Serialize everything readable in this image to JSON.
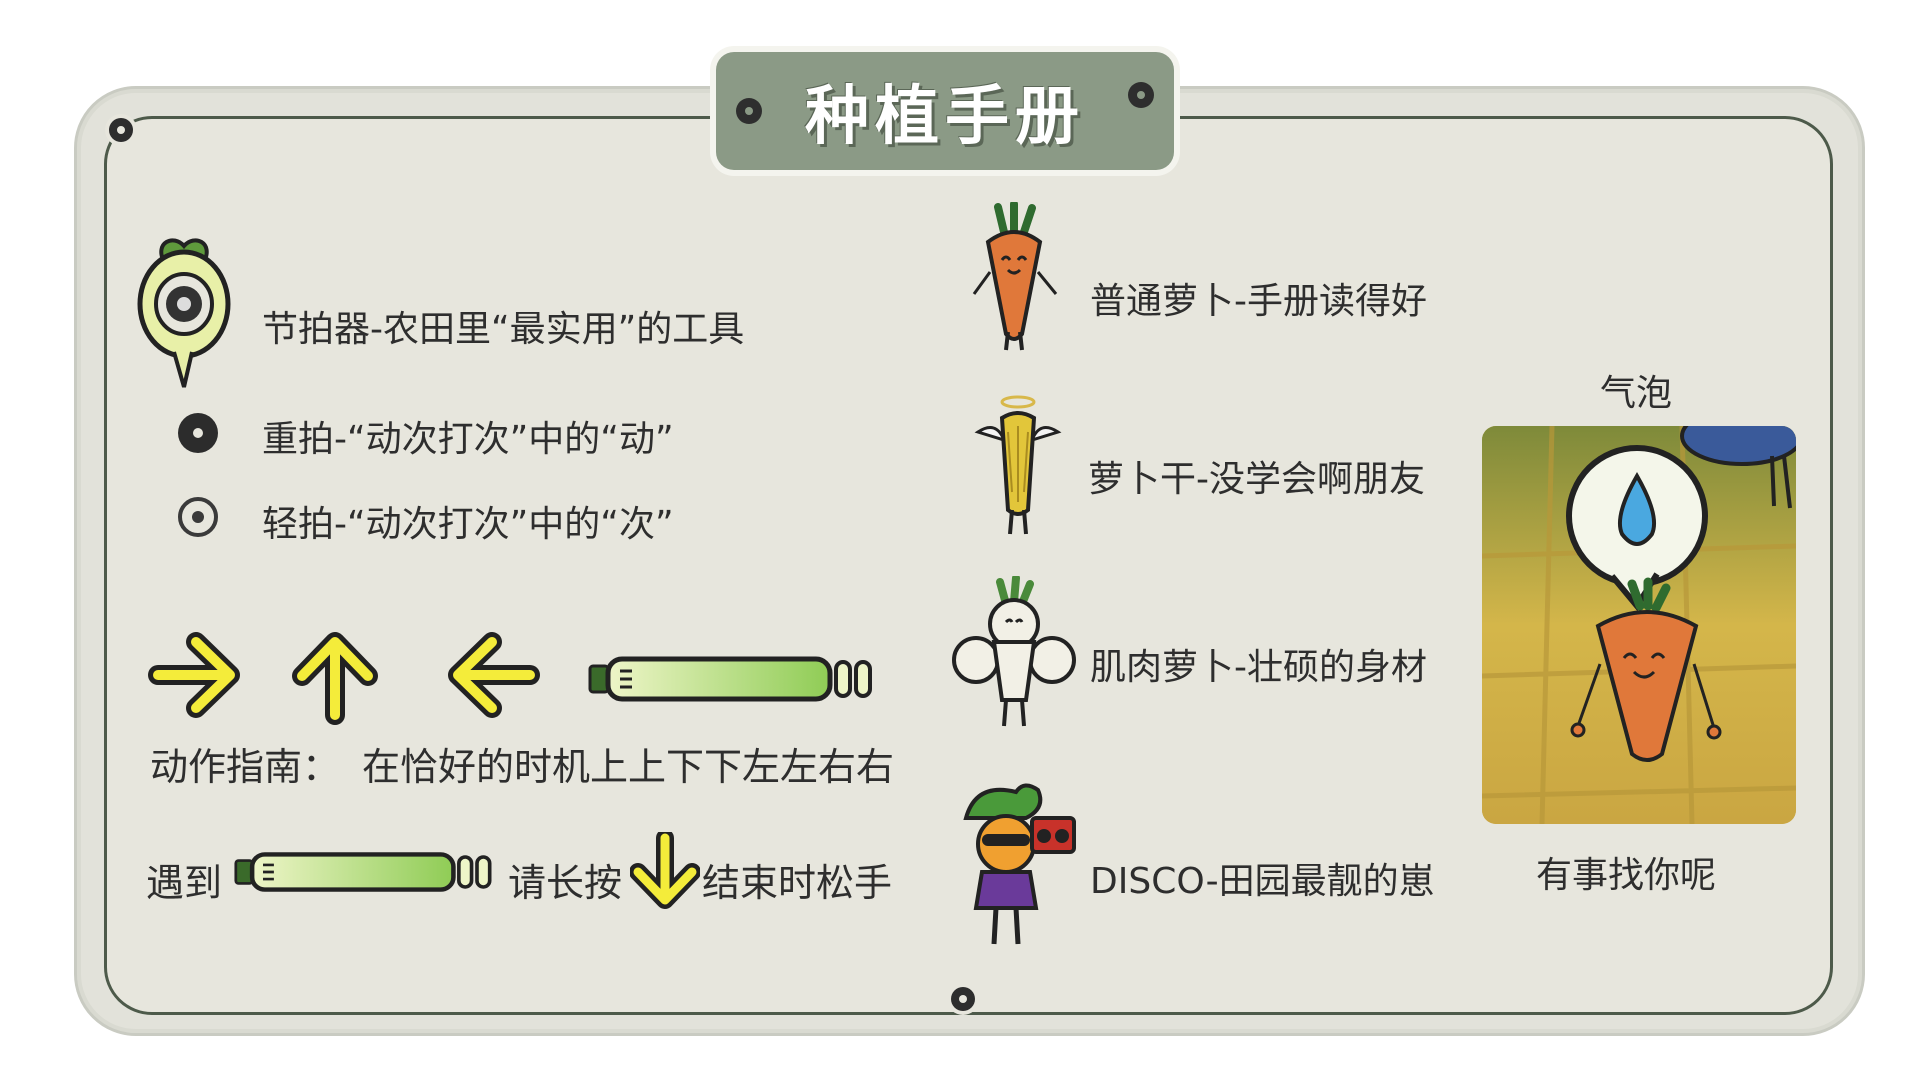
{
  "title": "种植手册",
  "metronome": {
    "desc": "节拍器-农田里“最实用”的工具",
    "heavy_beat": "重拍-“动次打次”中的“动”",
    "light_beat": "轻拍-“动次打次”中的“次”"
  },
  "guide": {
    "label": "动作指南：",
    "text": "在恰好的时机上上下下左左右右",
    "hold_prefix": "遇到",
    "hold_mid": "请长按",
    "hold_suffix": "结束时松手",
    "arrow_icons": [
      "arrow-right-icon",
      "arrow-up-icon",
      "arrow-left-icon",
      "hold-bar-icon",
      "arrow-down-icon"
    ]
  },
  "characters": [
    {
      "name": "普通萝卜-手册读得好",
      "icon": "carrot-icon"
    },
    {
      "name": "萝卜干-没学会啊朋友",
      "icon": "dried-radish-icon"
    },
    {
      "name": "肌肉萝卜-壮硕的身材",
      "icon": "muscle-radish-icon"
    },
    {
      "name": "DISCO-田园最靓的崽",
      "icon": "disco-radish-icon"
    }
  ],
  "bubble": {
    "title": "气泡",
    "caption": "有事找你呢"
  },
  "colors": {
    "panel": "#e7e6dd",
    "title_plate": "#8b9a86",
    "arrow_yellow": "#f4ec3a",
    "hold_green": "#9ccf5f",
    "carrot_orange": "#e0783a"
  }
}
